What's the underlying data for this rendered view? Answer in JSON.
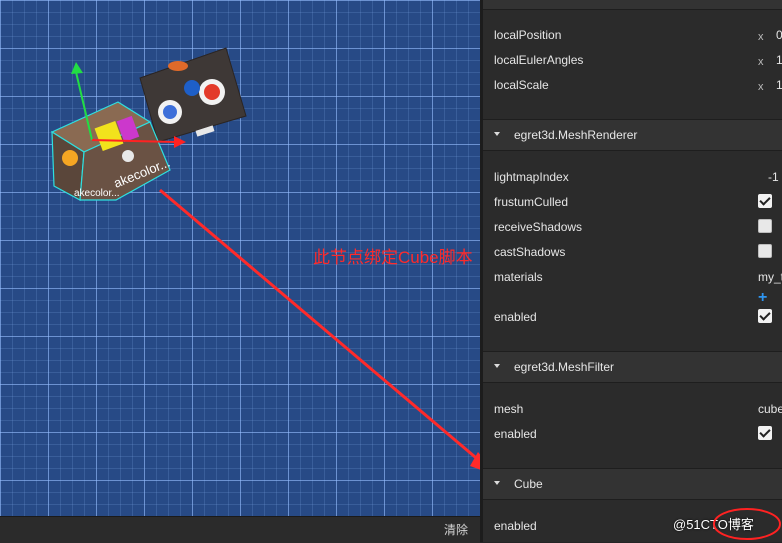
{
  "scene": {
    "clear_label": "清除",
    "cube_label_front": "akecolor...",
    "cube_label_side": "akecolor...",
    "annotation": "此节点绑定Cube脚本"
  },
  "inspector": {
    "transform": {
      "local_position": {
        "label": "localPosition",
        "axis": "x",
        "value": "0"
      },
      "local_euler_angles": {
        "label": "localEulerAngles",
        "axis": "x",
        "value": "1"
      },
      "local_scale": {
        "label": "localScale",
        "axis": "x",
        "value": "1"
      }
    },
    "mesh_renderer": {
      "title": "egret3d.MeshRenderer",
      "lightmap_index": {
        "label": "lightmapIndex",
        "value": "-1"
      },
      "frustum_culled": {
        "label": "frustumCulled",
        "checked": true
      },
      "receive_shadows": {
        "label": "receiveShadows",
        "checked": false
      },
      "cast_shadows": {
        "label": "castShadows",
        "checked": false
      },
      "materials": {
        "label": "materials",
        "value": "my_t",
        "add_icon": "+"
      },
      "enabled": {
        "label": "enabled",
        "checked": true
      }
    },
    "mesh_filter": {
      "title": "egret3d.MeshFilter",
      "mesh": {
        "label": "mesh",
        "value": "cube"
      },
      "enabled": {
        "label": "enabled",
        "checked": true
      }
    },
    "cube": {
      "title": "Cube",
      "enabled": {
        "label": "enabled"
      }
    }
  },
  "watermark": "@51CTO博客",
  "colors": {
    "panel_bg": "#2b2b2b",
    "header_bg": "#333333",
    "scene_bg": "#274a86",
    "annotation_red": "#ff2a2a",
    "gizmo_green": "#22dd44",
    "gizmo_red": "#ff2222",
    "add_blue": "#2e95f0"
  }
}
